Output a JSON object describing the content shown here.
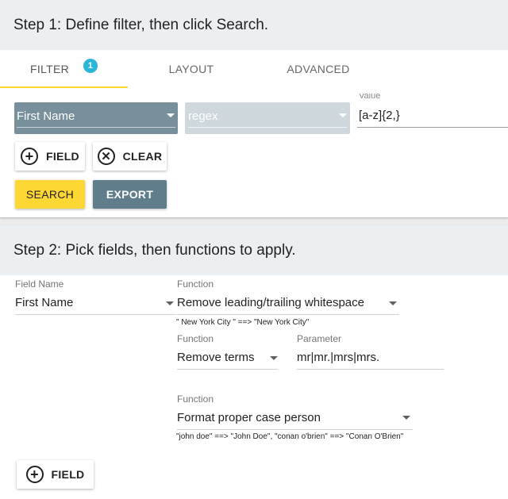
{
  "step1": {
    "title": "Step 1: Define filter, then click Search.",
    "tabs": [
      {
        "label": "FILTER",
        "badge": "1"
      },
      {
        "label": "LAYOUT"
      },
      {
        "label": "ADVANCED"
      }
    ],
    "field_select": "First Name",
    "operator_select": "regex",
    "value_label": "Value",
    "value": "[a-z]{2,}",
    "buttons": {
      "field": "FIELD",
      "clear": "CLEAR",
      "search": "SEARCH",
      "export": "EXPORT"
    }
  },
  "step2": {
    "title": "Step 2: Pick fields, then functions to apply.",
    "field_name_label": "Field Name",
    "field_name": "First Name",
    "functions": [
      {
        "label": "Function",
        "value": "Remove leading/trailing whitespace",
        "hint": "\" New York City \" ==> \"New York City\""
      },
      {
        "label": "Function",
        "value": "Remove terms",
        "param_label": "Parameter",
        "param_value": "mr|mr.|mrs|mrs."
      },
      {
        "label": "Function",
        "value": "Format proper case person",
        "hint": "\"john doe\" ==> \"John Doe\", \"conan o'brien\" ==> \"Conan O'Brien\""
      }
    ],
    "add_field_button": "FIELD"
  },
  "colors": {
    "header_bg": "#eceff1",
    "tab_underline": "#fdd835",
    "badge": "#29b6d8",
    "select_dark": "#78909c",
    "select_light": "#cfd8dc",
    "search_button": "#fdd835",
    "export_button": "#607d8b"
  },
  "icons": [
    "chevron-down-icon",
    "plus-circle-icon",
    "close-circle-icon"
  ]
}
